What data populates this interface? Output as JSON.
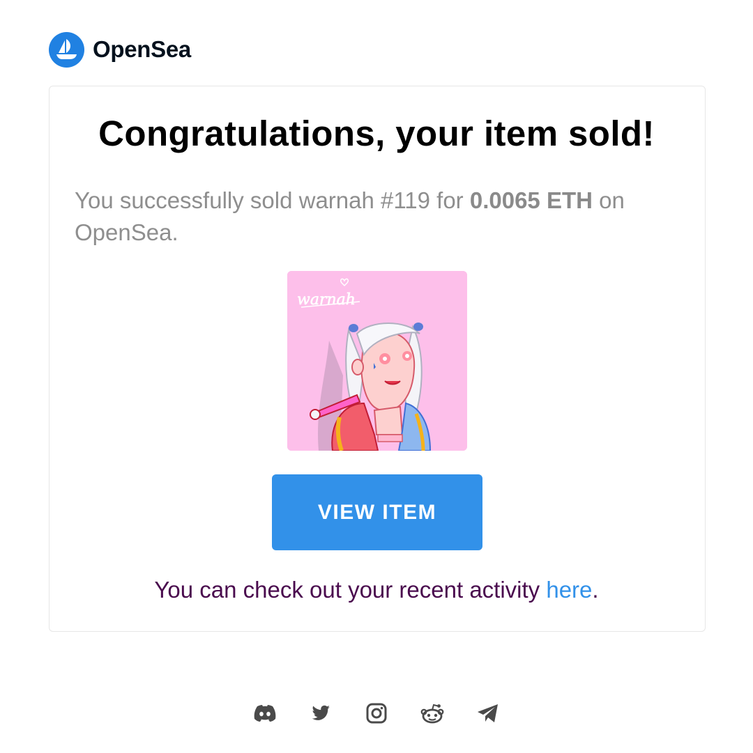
{
  "brand": {
    "name": "OpenSea",
    "color": "#2081E2"
  },
  "email": {
    "title": "Congratulations, your item sold!",
    "desc_prefix": "You successfully sold warnah #119 for ",
    "price": "0.0065 ETH",
    "desc_suffix": " on OpenSea.",
    "nft_signature": "warnah",
    "button_label": "VIEW ITEM",
    "activity_text": "You can check out your recent activity ",
    "activity_link": "here",
    "activity_end": "."
  },
  "colors": {
    "button": "#3291E9",
    "link": "#3291E9",
    "activity_text": "#4a0b4e",
    "nft_bg": "#FDBFEA"
  },
  "socials": [
    "discord-icon",
    "twitter-icon",
    "instagram-icon",
    "reddit-icon",
    "telegram-icon"
  ]
}
